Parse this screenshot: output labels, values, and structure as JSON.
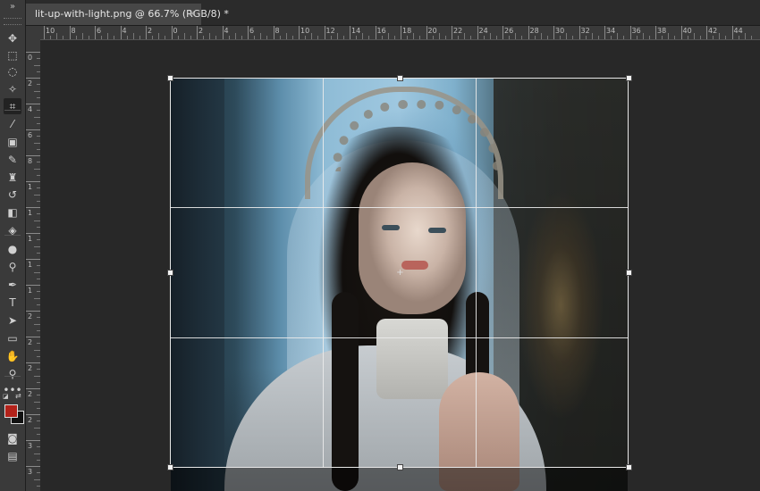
{
  "document_tab": {
    "title": "lit-up-with-light.png @ 66.7% (RGB/8) *",
    "close_glyph": "×"
  },
  "toolbar": {
    "collapse_glyph": "»",
    "tools": [
      {
        "name": "move-tool",
        "icon": "move-icon",
        "glyph": "✥",
        "active": false
      },
      {
        "name": "marquee-tool",
        "icon": "rect-marquee-icon",
        "glyph": "⬚",
        "active": false
      },
      {
        "name": "lasso-tool",
        "icon": "lasso-icon",
        "glyph": "◌",
        "active": false
      },
      {
        "name": "magic-wand-tool",
        "icon": "magic-wand-icon",
        "glyph": "✧",
        "active": false
      },
      {
        "name": "crop-tool",
        "icon": "crop-icon",
        "glyph": "⌗",
        "active": true
      },
      {
        "name": "eyedropper-tool",
        "icon": "eyedropper-icon",
        "glyph": "⁄",
        "active": false
      },
      {
        "name": "frame-tool",
        "icon": "frame-icon",
        "glyph": "▣",
        "active": false
      },
      {
        "name": "brush-tool",
        "icon": "brush-icon",
        "glyph": "✎",
        "active": false
      },
      {
        "name": "clone-stamp-tool",
        "icon": "stamp-icon",
        "glyph": "♜",
        "active": false
      },
      {
        "name": "history-brush-tool",
        "icon": "history-brush-icon",
        "glyph": "↺",
        "active": false
      },
      {
        "name": "eraser-tool",
        "icon": "eraser-icon",
        "glyph": "◧",
        "active": false
      },
      {
        "name": "paint-bucket-tool",
        "icon": "paint-bucket-icon",
        "glyph": "◈",
        "active": false
      },
      {
        "name": "blur-tool",
        "icon": "blur-drop-icon",
        "glyph": "●",
        "active": false
      },
      {
        "name": "dodge-tool",
        "icon": "dodge-icon",
        "glyph": "⚲",
        "active": false
      },
      {
        "name": "pen-tool",
        "icon": "pen-icon",
        "glyph": "✒",
        "active": false
      },
      {
        "name": "type-tool",
        "icon": "type-icon",
        "glyph": "T",
        "active": false
      },
      {
        "name": "path-selection-tool",
        "icon": "arrow-icon",
        "glyph": "➤",
        "active": false
      },
      {
        "name": "rectangle-tool",
        "icon": "rectangle-icon",
        "glyph": "▭",
        "active": false
      },
      {
        "name": "hand-tool",
        "icon": "hand-icon",
        "glyph": "✋",
        "active": false
      },
      {
        "name": "zoom-tool",
        "icon": "zoom-icon",
        "glyph": "⚲",
        "active": false
      },
      {
        "name": "more-tools",
        "icon": "ellipsis-icon",
        "glyph": "•••",
        "active": false
      }
    ],
    "foreground_color": "#b3221a",
    "background_color": "#111111",
    "quick_mask_glyph": "◙",
    "screen_mode_glyph": "▤"
  },
  "rulers": {
    "horizontal": [
      "10",
      "8",
      "6",
      "4",
      "2",
      "0",
      "2",
      "4",
      "6",
      "8",
      "10",
      "12",
      "14",
      "16",
      "18",
      "20",
      "22",
      "24",
      "26",
      "28",
      "30",
      "32",
      "34",
      "36",
      "38",
      "40",
      "42",
      "44"
    ],
    "vertical": [
      "0",
      "2",
      "4",
      "6",
      "8",
      "1",
      "1",
      "1",
      "1",
      "1",
      "2",
      "2",
      "2",
      "2",
      "2",
      "3",
      "3"
    ]
  },
  "canvas": {
    "background": "#282828"
  }
}
